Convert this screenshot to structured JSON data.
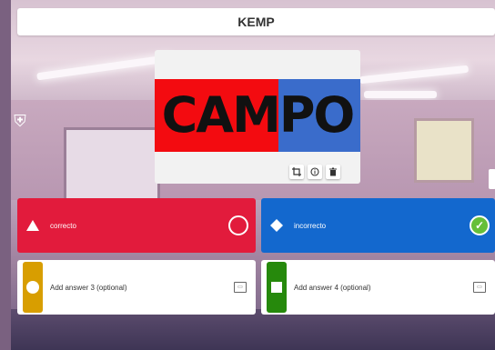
{
  "header": {
    "title": "KEMP"
  },
  "media": {
    "image_text": "CAMPO",
    "tools": [
      {
        "name": "crop-icon",
        "glyph": "⌗"
      },
      {
        "name": "info-icon",
        "glyph": "ⓘ"
      },
      {
        "name": "trash-icon",
        "glyph": "🗑"
      }
    ]
  },
  "answers": [
    {
      "label": "correcto",
      "color": "#e21b3c",
      "shape": "triangle",
      "marked_correct": false
    },
    {
      "label": "incorrecto",
      "color": "#1368ce",
      "shape": "diamond",
      "marked_correct": true
    },
    {
      "placeholder": "Add answer 3 (optional)",
      "color": "#d89e00",
      "shape": "circle"
    },
    {
      "placeholder": "Add answer 4 (optional)",
      "color": "#26890c",
      "shape": "square"
    }
  ]
}
